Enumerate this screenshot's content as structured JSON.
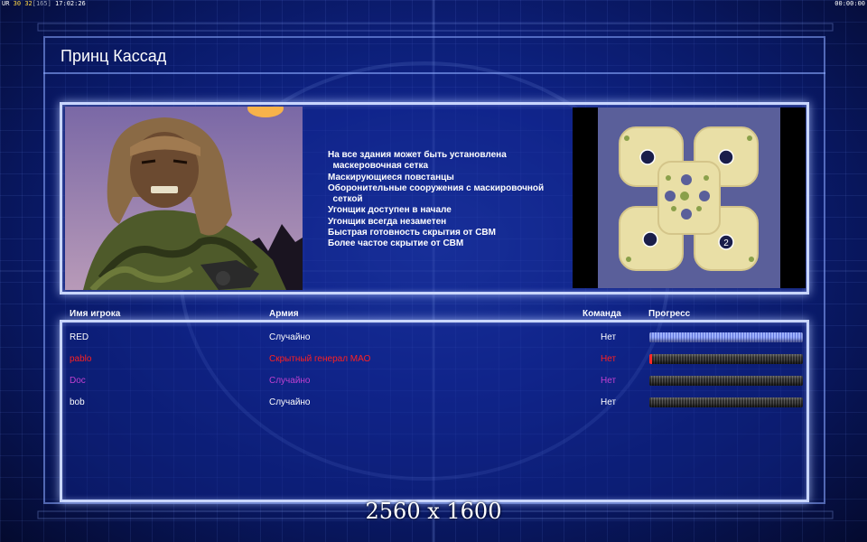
{
  "hud": {
    "resource_label": "UR",
    "resource_a": "30",
    "resource_b": "32",
    "resource_c": "[165]",
    "clock": "17:02:26",
    "timer": "00:00:00"
  },
  "screen": {
    "title": "Принц Кассад",
    "resolution_caption": "2560 x 1600"
  },
  "general": {
    "portrait_icon": "general-portrait",
    "features": [
      "На все здания может быть установлена",
      "  маскеровочная сетка",
      "Маскирующиеся повстанцы",
      "Оборонительные сооружения с маскировочной",
      "  сеткой",
      "Угонщик доступен в начале",
      "Угонщик всегда незаметен",
      "Быстрая готовность скрытия от СВМ",
      "Более частое скрытие от СВМ"
    ]
  },
  "map": {
    "icon": "minimap",
    "player_marker": "2"
  },
  "table": {
    "headers": {
      "name": "Имя игрока",
      "army": "Армия",
      "team": "Команда",
      "progress": "Прогресс"
    },
    "rows": [
      {
        "name": "RED",
        "army": "Случайно",
        "team": "Нет",
        "color": "#ffffff",
        "progress": 1.0
      },
      {
        "name": "pablo",
        "army": "Скрытный генерал МАО",
        "team": "Нет",
        "color": "#ff2020",
        "progress": 0.0
      },
      {
        "name": "Doc",
        "army": "Случайно",
        "team": "Нет",
        "color": "#c040d0",
        "progress": 0.0
      },
      {
        "name": "bob",
        "army": "Случайно",
        "team": "Нет",
        "color": "#ffffff",
        "progress": 0.0
      }
    ]
  }
}
